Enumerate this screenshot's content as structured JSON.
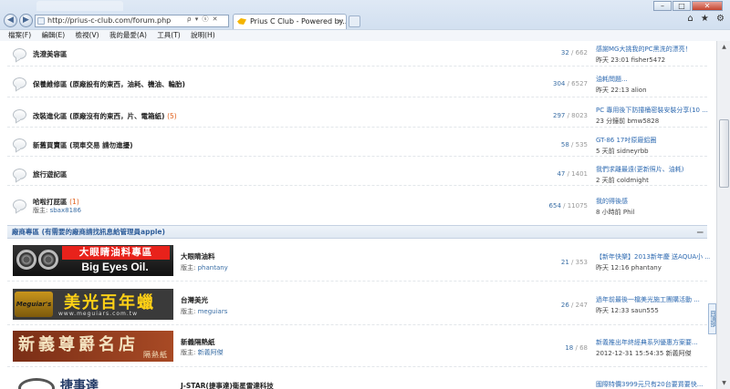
{
  "browser": {
    "address_url": "http://prius-c-club.com/forum.php",
    "address_tools": [
      "ρ",
      "▾",
      "ⓢ",
      "✕"
    ],
    "tab_title": "Prius C Club - Powered by...",
    "tab_close": "×",
    "window_controls": [
      "–",
      "□",
      "✕"
    ],
    "right_icons": [
      "home-icon",
      "star-icon",
      "gear-icon"
    ]
  },
  "menu": [
    {
      "label": "檔案(F)"
    },
    {
      "label": "編輯(E)"
    },
    {
      "label": "檢視(V)"
    },
    {
      "label": "我的最愛(A)"
    },
    {
      "label": "工具(T)"
    },
    {
      "label": "說明(H)"
    }
  ],
  "forums": [
    {
      "name": "洗澄美容區",
      "new": "",
      "moderator_label": "",
      "moderator": "",
      "topics": "32",
      "posts": "662",
      "last_title": "感謝MG大挑我的PC黑洗的漂亮！",
      "last_meta": "昨天 23:01 fisher5472"
    },
    {
      "name": "保養維修區 (原廠設有的東西，油耗、機油、輪胎)",
      "new": "",
      "moderator_label": "",
      "moderator": "",
      "topics": "304",
      "posts": "6527",
      "last_title": "油耗問題...",
      "last_meta": "昨天 22:13 alion"
    },
    {
      "name": "改裝進化區 (原廠沒有的東西，片、電箱紙)",
      "new": "(5)",
      "moderator_label": "",
      "moderator": "",
      "topics": "297",
      "posts": "8023",
      "last_title": "PC 專用後下防撞桶密裝安裝分享(10 ...",
      "last_meta": "23 分鐘前 bmw5828"
    },
    {
      "name": "新舊買賣區 (現車交易 請勿進擾)",
      "new": "",
      "moderator_label": "",
      "moderator": "",
      "topics": "58",
      "posts": "535",
      "last_title": "GT-86 17吋原廠鋁圈",
      "last_meta": "5 天前 sidneyrbb"
    },
    {
      "name": "旅行遊記區",
      "new": "",
      "moderator_label": "",
      "moderator": "",
      "topics": "47",
      "posts": "1401",
      "last_title": "我們求離最遠(更新照片、油耗)",
      "last_meta": "2 天前 coldmight"
    },
    {
      "name": "哈啦打屁區",
      "new": "(1)",
      "moderator_label": "版主:",
      "moderator": "sbax8186",
      "topics": "654",
      "posts": "11075",
      "last_title": "我的得後感",
      "last_meta": "8 小時前 Phil"
    }
  ],
  "category": {
    "title": "廠商專區 (有需要的廠商請找訊息給管理員apple)",
    "collapse": "—"
  },
  "vendors": [
    {
      "name": "大眼睛油料",
      "moderator_label": "版主:",
      "moderator": "phantany",
      "topics": "21",
      "posts": "353",
      "last_title": "【新年快樂】2013新年慶 送AQUA小 ...",
      "last_meta": "昨天 12:16 phantany",
      "banner_line1": "大眼睛油料專區",
      "banner_line2": "Big Eyes Oil."
    },
    {
      "name": "台灣美光",
      "moderator_label": "版主:",
      "moderator": "meguiars",
      "topics": "26",
      "posts": "247",
      "last_title": "過年前最後一檔美光施工團購活動 ...",
      "last_meta": "昨天 12:33 saun555",
      "banner_logo": "Meguiar's",
      "banner_line1": "美光百年蠟",
      "banner_line2": "www.meguiars.com.tw"
    },
    {
      "name": "新義隔熱紙",
      "moderator_label": "版主:",
      "moderator": "新義阿傑",
      "topics": "18",
      "posts": "68",
      "last_title": "新義推出年終經典系列優惠方案要...",
      "last_meta": "2012-12-31 15:54:35 新義阿傑",
      "banner_line1": "新義尊爵名店",
      "banner_line2": "隔熱紙"
    },
    {
      "name": "J-STAR(捷事達)衛星雷達科技",
      "moderator_label": "",
      "moderator": "",
      "topics": "",
      "posts": "",
      "last_title": "國際特價3999元只有20台要買要快...",
      "last_meta": "",
      "banner_line1": "捷事達"
    }
  ],
  "side_tab": "回頂部",
  "scroll_up": "▲",
  "scroll_down": "▼"
}
